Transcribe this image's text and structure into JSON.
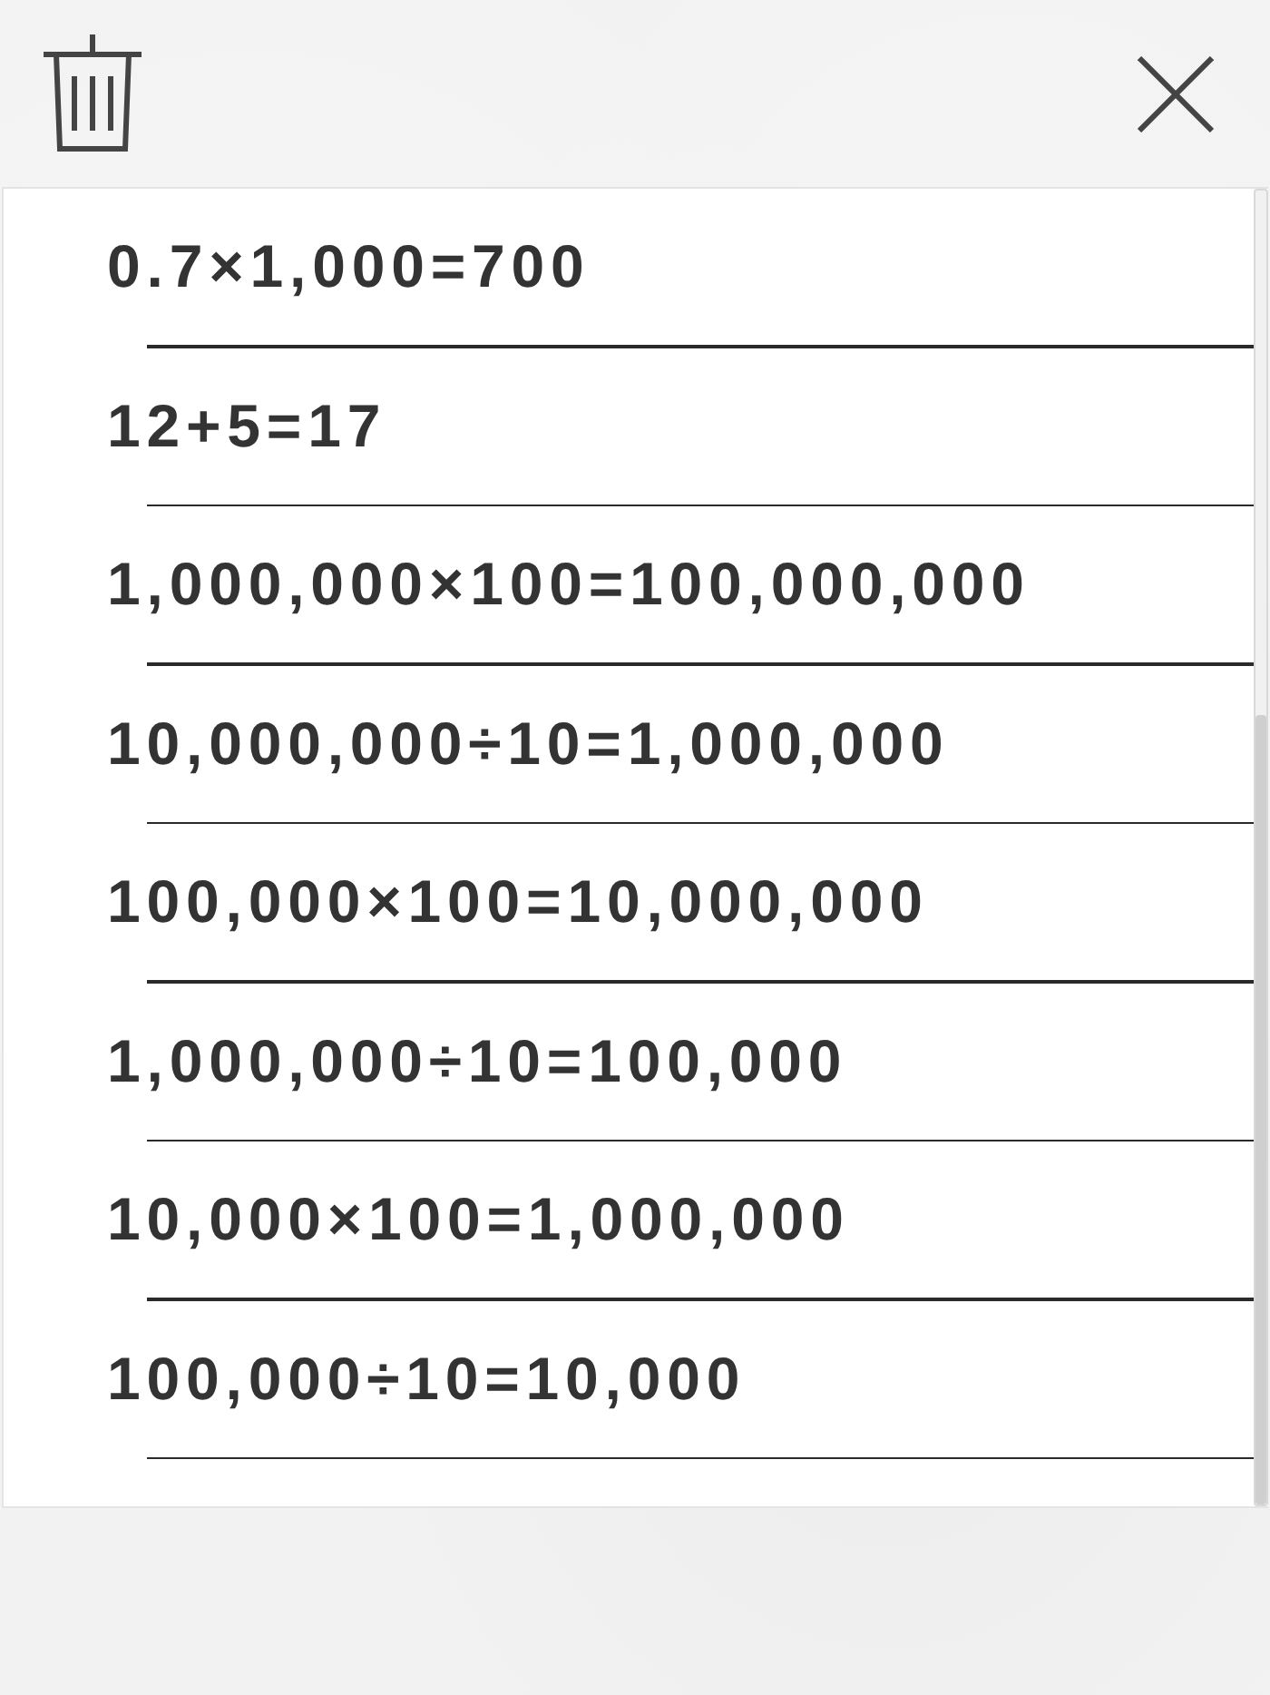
{
  "history": [
    {
      "text": "0.7×1,000=700"
    },
    {
      "text": "12+5=17"
    },
    {
      "text": "1,000,000×100=100,000,000"
    },
    {
      "text": "10,000,000÷10=1,000,000"
    },
    {
      "text": "100,000×100=10,000,000"
    },
    {
      "text": "1,000,000÷10=100,000"
    },
    {
      "text": "10,000×100=1,000,000"
    },
    {
      "text": "100,000÷10=10,000"
    }
  ]
}
